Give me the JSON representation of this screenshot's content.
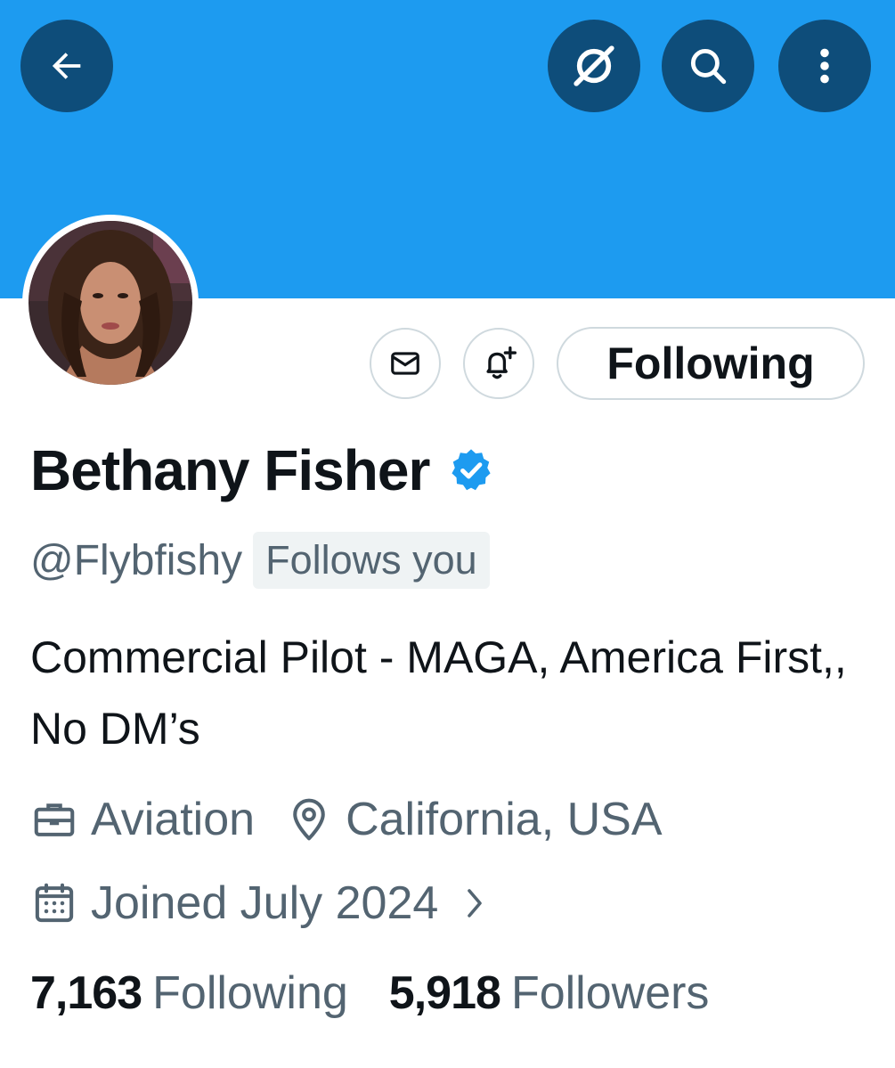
{
  "header": {
    "back_icon": "arrow-left-icon",
    "grok_icon": "grok-icon",
    "search_icon": "search-icon",
    "more_icon": "more-vertical-icon",
    "banner_color": "#1d9bf0"
  },
  "profile": {
    "name": "Bethany Fisher",
    "handle": "@Flybfishy",
    "follows_you": "Follows you",
    "verified": true,
    "bio": "Commercial Pilot - MAGA, America First,, No DM’s",
    "category": "Aviation",
    "location": "California, USA",
    "joined": "Joined July 2024"
  },
  "actions": {
    "message_icon": "envelope-icon",
    "notify_icon": "bell-plus-icon",
    "following_label": "Following"
  },
  "stats": {
    "following_count": "7,163",
    "following_label": "Following",
    "followers_count": "5,918",
    "followers_label": "Followers"
  },
  "colors": {
    "accent": "#1d9bf0",
    "text_primary": "#0f1419",
    "text_secondary": "#536471"
  }
}
